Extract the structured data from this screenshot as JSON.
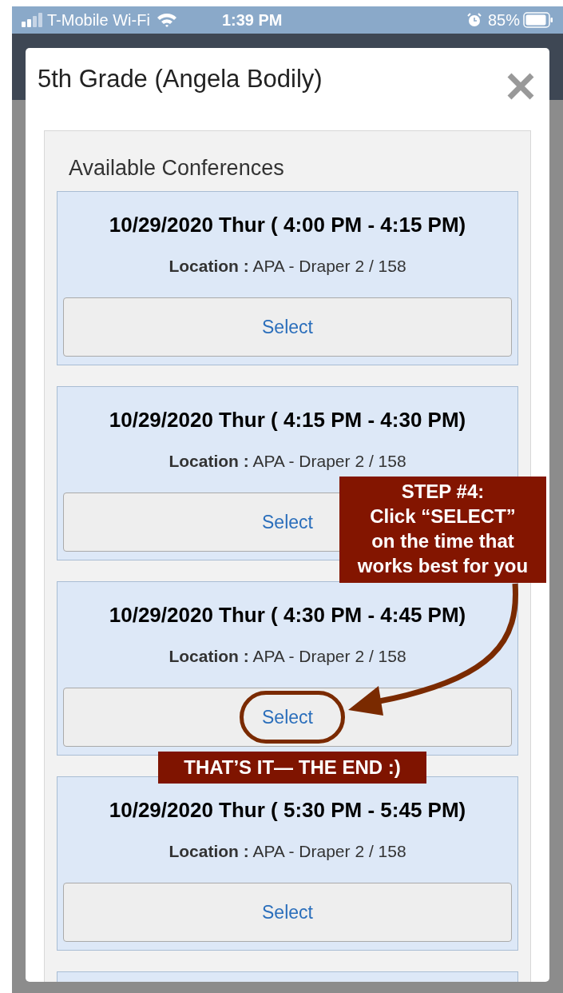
{
  "status_bar": {
    "carrier": "T-Mobile Wi-Fi",
    "time": "1:39 PM",
    "battery": "85%"
  },
  "modal": {
    "title": "5th Grade (Angela Bodily)",
    "section_title": "Available Conferences",
    "conferences": [
      {
        "time": "10/29/2020 Thur ( 4:00 PM - 4:15 PM)",
        "location_label": "Location :",
        "location": "APA - Draper 2 / 158",
        "button": "Select",
        "circled": false
      },
      {
        "time": "10/29/2020 Thur ( 4:15 PM - 4:30 PM)",
        "location_label": "Location :",
        "location": "APA - Draper 2 / 158",
        "button": "Select",
        "circled": false
      },
      {
        "time": "10/29/2020 Thur ( 4:30 PM - 4:45 PM)",
        "location_label": "Location :",
        "location": "APA - Draper 2 / 158",
        "button": "Select",
        "circled": true
      },
      {
        "time": "10/29/2020 Thur ( 5:30 PM - 5:45 PM)",
        "location_label": "Location :",
        "location": "APA - Draper 2 / 158",
        "button": "Select",
        "circled": false
      }
    ]
  },
  "annotations": {
    "callout": "STEP #4:\nClick “SELECT”\non the time that\nworks best for you",
    "banner": "THAT’S IT— THE END :)"
  }
}
